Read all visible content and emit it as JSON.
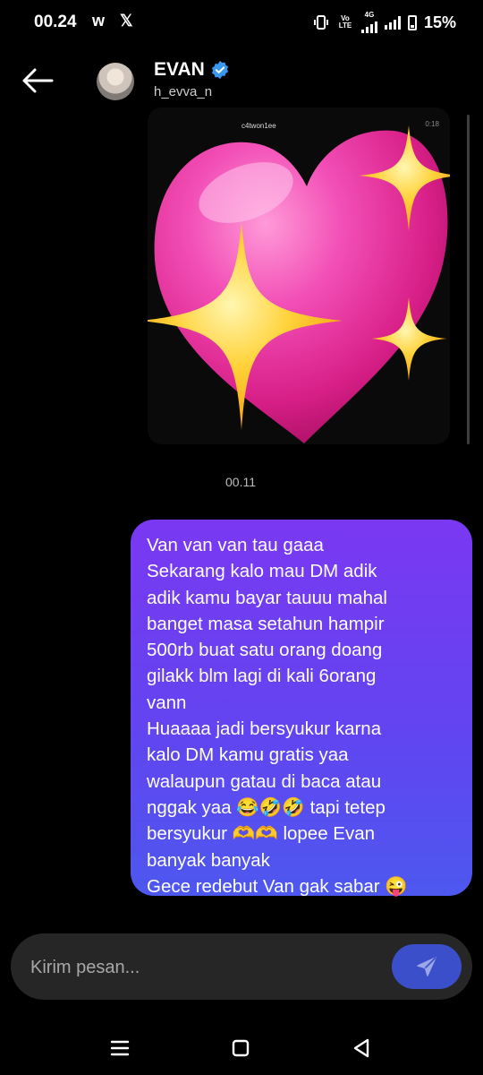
{
  "status_bar": {
    "time": "00.24",
    "app_icons": "w 𝕏",
    "volte": "Vo LTE",
    "network": "4G",
    "battery": "15%"
  },
  "header": {
    "name": "EVAN",
    "handle": "h_evva_n",
    "back_icon": "arrow-left-icon",
    "verified_icon": "verified-badge-icon"
  },
  "shared_post": {
    "username": "c4twon1ee",
    "time": "0:18",
    "sticker": "sparkling-heart-sticker"
  },
  "timestamp": "00.11",
  "message": {
    "lines": [
      "Van van van tau gaaa",
      "Sekarang kalo mau DM adik",
      "adik kamu bayar tauuu mahal",
      "banget masa setahun hampir",
      "500rb buat satu orang doang",
      "gilakk blm lagi di kali 6orang",
      "vann",
      "Huaaaa jadi bersyukur karna",
      "kalo DM kamu gratis yaa",
      "walaupun gatau di baca atau",
      "nggak yaa 😂🤣🤣 tapi tetep",
      "bersyukur 🫶🫶 lopee Evan",
      "banyak banyak",
      "Gece redebut Van gak sabar 😜"
    ],
    "gradient_top": "#7a38f2",
    "gradient_bottom": "#4d58ef"
  },
  "composer": {
    "placeholder": "Kirim pesan...",
    "value": "",
    "send_icon": "send-icon",
    "accent": "#3a4fc9"
  },
  "navbar": {
    "icons": [
      "recents-icon",
      "home-icon",
      "back-icon"
    ]
  }
}
